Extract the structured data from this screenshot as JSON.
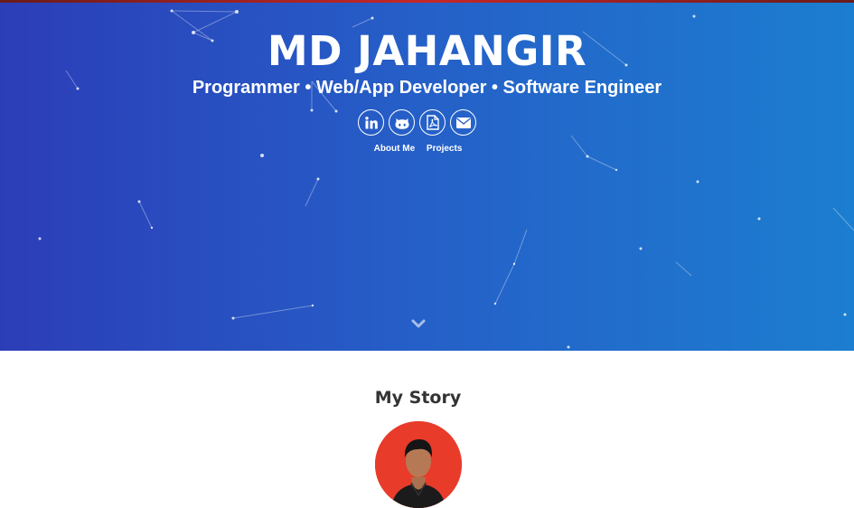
{
  "hero": {
    "title": "MD JAHANGIR",
    "subtitle": "Programmer • Web/App Developer • Software Engineer",
    "background_colors": [
      "#2c3db8",
      "#1c7ed0"
    ]
  },
  "social": [
    {
      "name": "linkedin",
      "icon": "linkedin-icon"
    },
    {
      "name": "github",
      "icon": "github-icon"
    },
    {
      "name": "resume-pdf",
      "icon": "pdf-icon"
    },
    {
      "name": "email",
      "icon": "mail-icon"
    }
  ],
  "nav": {
    "about_label": "About Me",
    "projects_label": "Projects"
  },
  "story": {
    "title": "My Story",
    "avatar_bg": "#e83b2a"
  }
}
